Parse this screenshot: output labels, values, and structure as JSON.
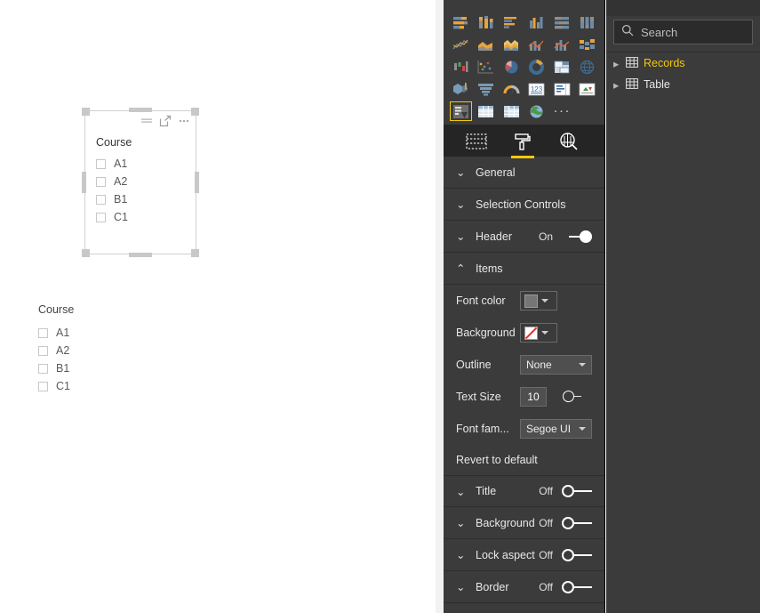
{
  "canvas": {
    "selected_visual": {
      "name": "slicer-visual-selected",
      "header_icons": [
        "filter-sort-icon",
        "focus-mode-icon",
        "more-options-icon"
      ],
      "title": "Course",
      "items": [
        {
          "label": "A1",
          "checked": false
        },
        {
          "label": "A2",
          "checked": false
        },
        {
          "label": "B1",
          "checked": false
        },
        {
          "label": "C1",
          "checked": false
        }
      ]
    },
    "second_visual": {
      "name": "slicer-visual-plain",
      "title": "Course",
      "items": [
        {
          "label": "A1",
          "checked": false
        },
        {
          "label": "A2",
          "checked": false
        },
        {
          "label": "B1",
          "checked": false
        },
        {
          "label": "C1",
          "checked": false
        }
      ]
    }
  },
  "visualizations": {
    "gallery": [
      {
        "name": "stacked-bar-chart-icon",
        "selected": false
      },
      {
        "name": "stacked-column-chart-icon",
        "selected": false
      },
      {
        "name": "clustered-bar-chart-icon",
        "selected": false
      },
      {
        "name": "clustered-column-chart-icon",
        "selected": false
      },
      {
        "name": "hundred-percent-stacked-bar-chart-icon",
        "selected": false
      },
      {
        "name": "hundred-percent-stacked-column-chart-icon",
        "selected": false
      },
      {
        "name": "line-chart-icon",
        "selected": false
      },
      {
        "name": "area-chart-icon",
        "selected": false
      },
      {
        "name": "stacked-area-chart-icon",
        "selected": false
      },
      {
        "name": "line-and-stacked-column-chart-icon",
        "selected": false
      },
      {
        "name": "line-and-clustered-column-chart-icon",
        "selected": false
      },
      {
        "name": "ribbon-chart-icon",
        "selected": false
      },
      {
        "name": "waterfall-chart-icon",
        "selected": false
      },
      {
        "name": "scatter-chart-icon",
        "selected": false
      },
      {
        "name": "pie-chart-icon",
        "selected": false
      },
      {
        "name": "donut-chart-icon",
        "selected": false
      },
      {
        "name": "treemap-icon",
        "selected": false
      },
      {
        "name": "map-icon",
        "selected": false
      },
      {
        "name": "filled-map-icon",
        "selected": false
      },
      {
        "name": "funnel-chart-icon",
        "selected": false
      },
      {
        "name": "gauge-chart-icon",
        "selected": false
      },
      {
        "name": "card-icon",
        "selected": false
      },
      {
        "name": "multi-row-card-icon",
        "selected": false
      },
      {
        "name": "kpi-icon",
        "selected": false
      },
      {
        "name": "slicer-icon",
        "selected": true
      },
      {
        "name": "table-icon",
        "selected": false
      },
      {
        "name": "matrix-icon",
        "selected": false
      },
      {
        "name": "arcgis-map-icon",
        "selected": false
      }
    ],
    "more_label": "···",
    "tabs": [
      {
        "name": "fields-tab",
        "icon": "fields-grid-icon",
        "active": false
      },
      {
        "name": "format-tab",
        "icon": "paint-roller-icon",
        "active": true
      },
      {
        "name": "analytics-tab",
        "icon": "magnifier-chart-icon",
        "active": false
      }
    ]
  },
  "format_pane": {
    "sections": [
      {
        "label": "General",
        "expanded": false,
        "toggle": null
      },
      {
        "label": "Selection Controls",
        "expanded": false,
        "toggle": null
      },
      {
        "label": "Header",
        "expanded": false,
        "toggle": "On"
      },
      {
        "label": "Items",
        "expanded": true,
        "toggle": null
      }
    ],
    "items_controls": {
      "font_color": {
        "label": "Font color",
        "swatch_color": "#767676"
      },
      "background": {
        "label": "Background",
        "swatch_color": "#ffffff",
        "state": "none"
      },
      "outline": {
        "label": "Outline",
        "value": "None"
      },
      "text_size": {
        "label": "Text Size",
        "value": "10"
      },
      "font_family": {
        "label": "Font fam...",
        "value": "Segoe UI"
      },
      "revert": "Revert to default"
    },
    "bottom_sections": [
      {
        "label": "Title",
        "toggle": "Off"
      },
      {
        "label": "Background",
        "toggle": "Off"
      },
      {
        "label": "Lock aspect",
        "toggle": "Off"
      },
      {
        "label": "Border",
        "toggle": "Off"
      }
    ]
  },
  "fields_pane": {
    "search": {
      "placeholder": "Search",
      "value": ""
    },
    "tables": [
      {
        "label": "Records",
        "highlight": true
      },
      {
        "label": "Table",
        "highlight": false
      }
    ]
  },
  "colors": {
    "accent": "#f2c811",
    "pane_bg": "#3b3b3b",
    "tabs_bg": "#252525",
    "canvas_bg": "#ffffff"
  }
}
